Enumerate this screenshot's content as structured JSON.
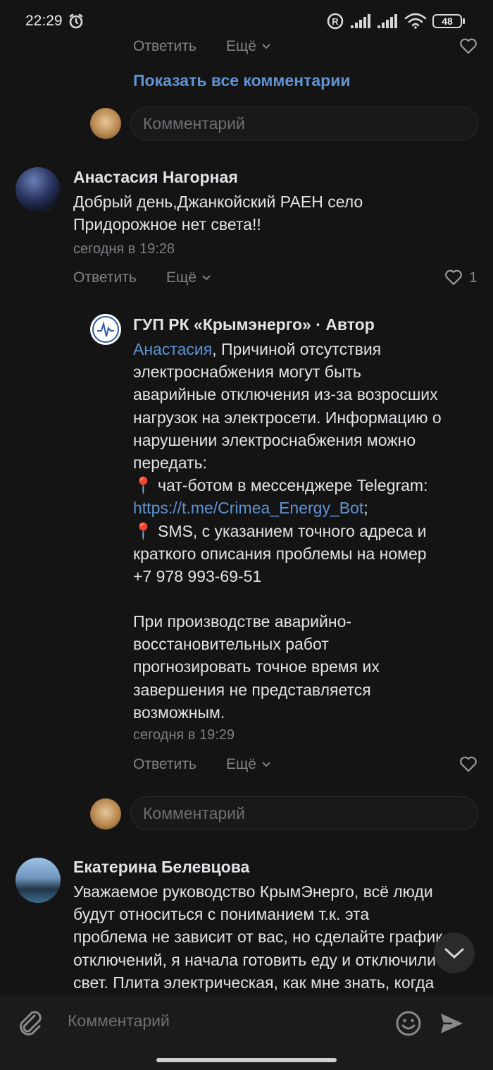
{
  "status_bar": {
    "time": "22:29",
    "battery": "48",
    "icons": [
      "alarm-icon",
      "registered-icon",
      "signal-icon",
      "signal-icon",
      "wifi-icon",
      "battery-icon"
    ]
  },
  "top": {
    "reply": "Ответить",
    "more": "Ещё",
    "show_all": "Показать все комментарии",
    "comment_placeholder": "Комментарий"
  },
  "comments": [
    {
      "author": "Анастасия Нагорная",
      "text": "Добрый день,Джанкойский РАЕН село\nПридорожное нет света!!",
      "time": "сегодня в 19:28",
      "reply": "Ответить",
      "more": "Ещё",
      "likes": "1"
    }
  ],
  "reply": {
    "author": "ГУП РК «Крымэнерго» · Автор",
    "mention": "Анастасия",
    "text_1": ", Причиной отсутствия\nэлектроснабжения могут быть\nаварийные отключения из-за возросших\nнагрузок на электросети. Информацию о\nнарушении электроснабжения можно\nпередать:",
    "pin": "📍",
    "bullet_1": " чат-ботом в мессенджере Telegram:",
    "link": "https://t.me/Crimea_Energy_Bot",
    "link_suffix": ";",
    "bullet_2": " SMS, с указанием точного адреса и\nкраткого описания проблемы на номер\n+7 978 993-69-51",
    "text_2": "При производстве аварийно-\nвосстановительных работ\nпрогнозировать точное время их\nзавершения не представляется\nвозможным.",
    "time": "сегодня в 19:29",
    "reply_label": "Ответить",
    "more": "Ещё",
    "comment_placeholder": "Комментарий"
  },
  "comment3": {
    "author": "Екатерина Белевцова",
    "text": "Уважаемое руководство КрымЭнерго, всё люди\nбудут относиться с пониманием т.к. эта\nпроблема не зависит от вас, но сделайте график\nотключений, я начала готовить еду и отключили\nсвет. Плита электрическая, как мне знать, когда"
  },
  "bottom": {
    "placeholder": "Комментарий"
  },
  "colors": {
    "background": "#141414",
    "link": "#5f93d3",
    "muted": "#828282"
  }
}
